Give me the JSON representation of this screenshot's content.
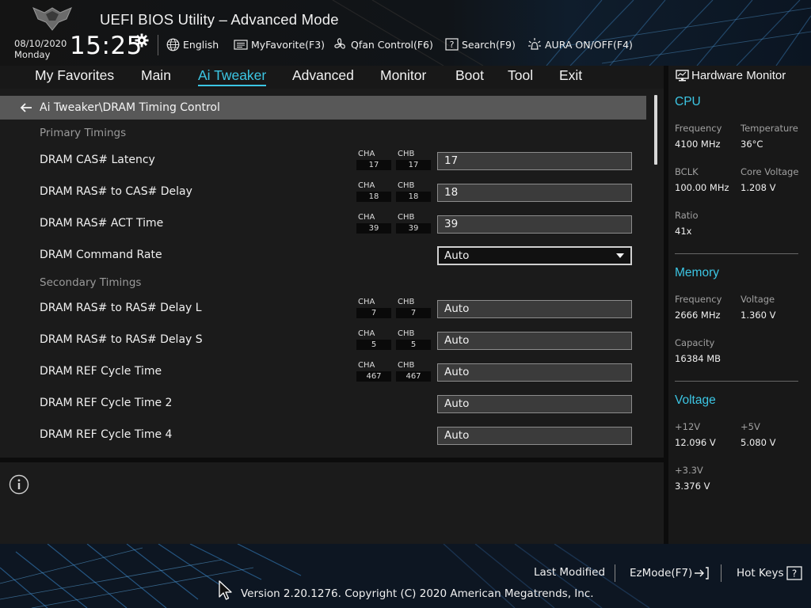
{
  "header": {
    "title": "UEFI BIOS Utility – Advanced Mode",
    "date": "08/10/2020",
    "day": "Monday",
    "time": "15:25",
    "toolbar": [
      {
        "label": "English",
        "icon": "globe-icon"
      },
      {
        "label": "MyFavorite(F3)",
        "icon": "favorite-icon"
      },
      {
        "label": "Qfan Control(F6)",
        "icon": "fan-icon"
      },
      {
        "label": "Search(F9)",
        "icon": "search-help-icon"
      },
      {
        "label": "AURA ON/OFF(F4)",
        "icon": "aura-icon"
      }
    ]
  },
  "menu": {
    "items": [
      "My Favorites",
      "Main",
      "Ai Tweaker",
      "Advanced",
      "Monitor",
      "Boot",
      "Tool",
      "Exit"
    ],
    "active": "Ai Tweaker"
  },
  "breadcrumb": "Ai Tweaker\\DRAM Timing Control",
  "sections": {
    "primary": "Primary Timings",
    "secondary": "Secondary Timings"
  },
  "channels": {
    "a": "CHA",
    "b": "CHB"
  },
  "rows": [
    {
      "label": "DRAM CAS# Latency",
      "cha": "17",
      "chb": "17",
      "value": "17"
    },
    {
      "label": "DRAM RAS# to CAS# Delay",
      "cha": "18",
      "chb": "18",
      "value": "18"
    },
    {
      "label": "DRAM RAS# ACT Time",
      "cha": "39",
      "chb": "39",
      "value": "39"
    },
    {
      "label": "DRAM Command Rate",
      "value": "Auto"
    },
    {
      "label": "DRAM RAS# to RAS# Delay L",
      "cha": "7",
      "chb": "7",
      "value": "Auto"
    },
    {
      "label": "DRAM RAS# to RAS# Delay S",
      "cha": "5",
      "chb": "5",
      "value": "Auto"
    },
    {
      "label": "DRAM REF Cycle Time",
      "cha": "467",
      "chb": "467",
      "value": "Auto"
    },
    {
      "label": "DRAM REF Cycle Time 2",
      "value": "Auto"
    },
    {
      "label": "DRAM REF Cycle Time 4",
      "value": "Auto"
    }
  ],
  "hwmon": {
    "title": "Hardware Monitor",
    "cpu": {
      "title": "CPU",
      "frequency_label": "Frequency",
      "frequency": "4100 MHz",
      "temperature_label": "Temperature",
      "temperature": "36°C",
      "bclk_label": "BCLK",
      "bclk": "100.00 MHz",
      "core_voltage_label": "Core Voltage",
      "core_voltage": "1.208 V",
      "ratio_label": "Ratio",
      "ratio": "41x"
    },
    "memory": {
      "title": "Memory",
      "frequency_label": "Frequency",
      "frequency": "2666 MHz",
      "voltage_label": "Voltage",
      "voltage": "1.360 V",
      "capacity_label": "Capacity",
      "capacity": "16384 MB"
    },
    "voltage": {
      "title": "Voltage",
      "v12_label": "+12V",
      "v12": "12.096 V",
      "v5_label": "+5V",
      "v5": "5.080 V",
      "v33_label": "+3.3V",
      "v33": "3.376 V"
    }
  },
  "footer": {
    "last_modified": "Last Modified",
    "ezmode": "EzMode(F7)",
    "hotkeys": "Hot Keys",
    "version": "Version 2.20.1276. Copyright (C) 2020 American Megatrends, Inc."
  },
  "colors": {
    "accent": "#3cc6e4",
    "panel": "#1b1b1b",
    "breadcrumb_bg": "#585858",
    "value_box_bg": "#3b3b3b"
  }
}
